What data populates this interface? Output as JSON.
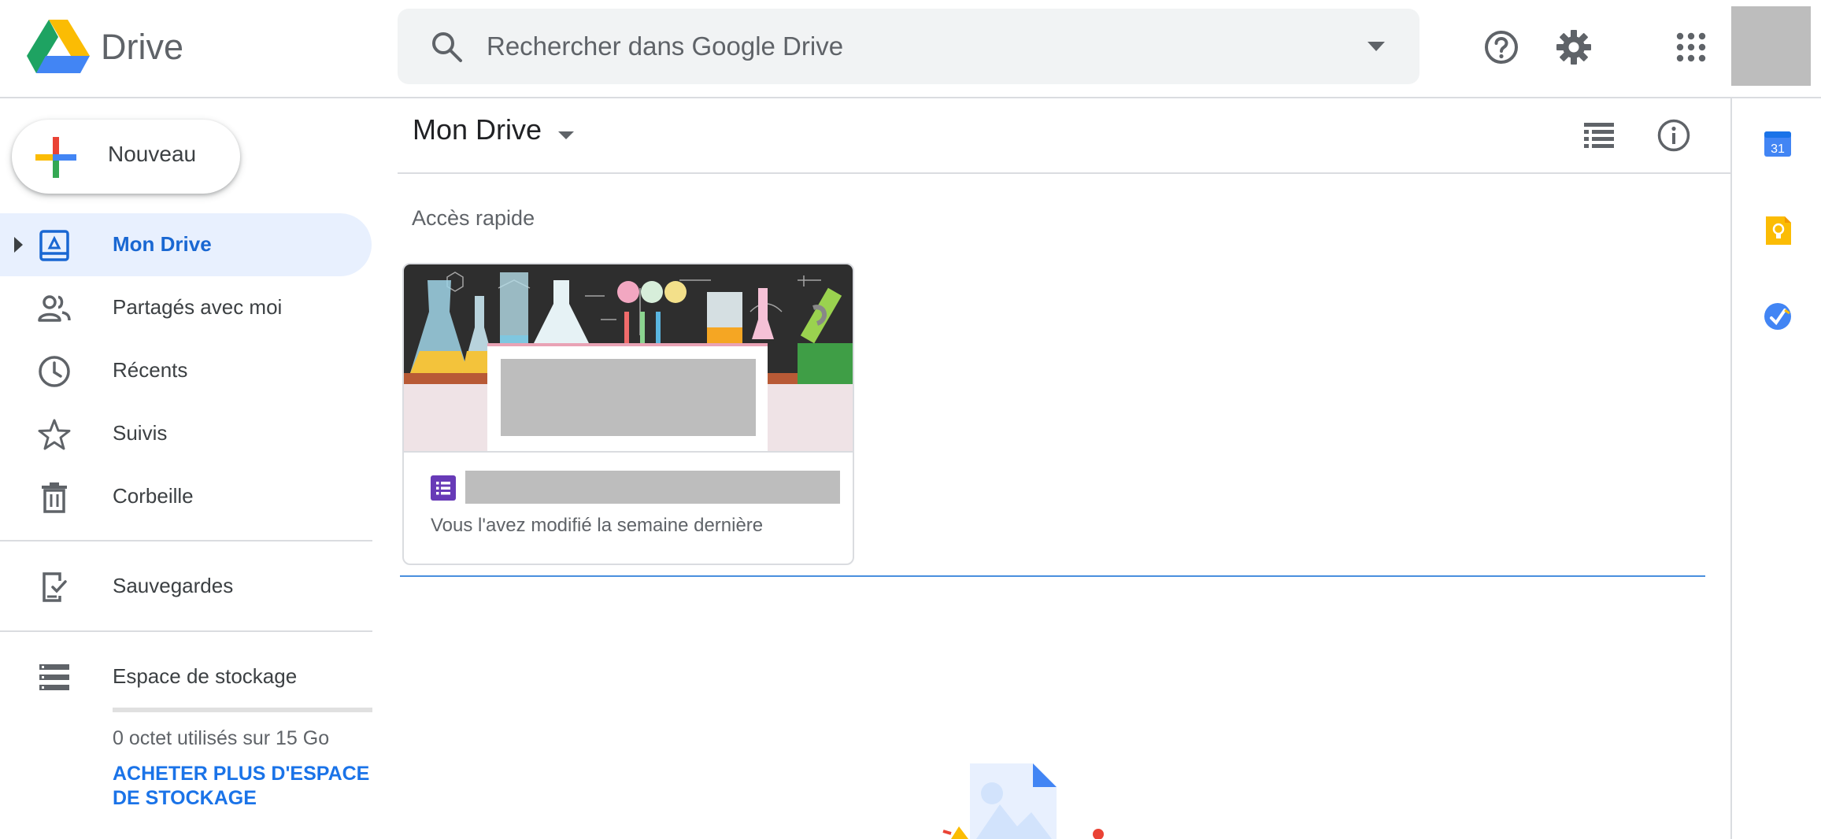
{
  "header": {
    "app_title": "Drive",
    "search_placeholder": "Rechercher dans Google Drive",
    "icons": [
      "google-drive-logo",
      "search-icon",
      "search-options-dropdown-icon",
      "help-icon",
      "settings-gear-icon",
      "apps-grid-icon",
      "account-avatar"
    ]
  },
  "sidebar": {
    "new_button_label": "Nouveau",
    "items": [
      {
        "label": "Mon Drive",
        "icon": "my-drive-icon",
        "selected": true
      },
      {
        "label": "Partagés avec moi",
        "icon": "people-icon"
      },
      {
        "label": "Récents",
        "icon": "clock-icon"
      },
      {
        "label": "Suivis",
        "icon": "star-icon"
      },
      {
        "label": "Corbeille",
        "icon": "trash-icon"
      },
      {
        "label": "Sauvegardes",
        "icon": "backup-device-icon"
      },
      {
        "label": "Espace de stockage",
        "icon": "storage-icon"
      }
    ],
    "storage_used_text": "0 octet utilisés sur 15 Go",
    "storage_used_fraction": 0,
    "buy_storage_label": "ACHETER PLUS D'ESPACE DE STOCKAGE"
  },
  "main": {
    "title": "Mon Drive",
    "quick_access_label": "Accès rapide",
    "cards": [
      {
        "type": "google-forms",
        "modified_text": "Vous l'avez modifié la semaine dernière"
      }
    ],
    "toolbar_icons": [
      "list-view-icon",
      "info-icon"
    ]
  },
  "side_panel": {
    "icons": [
      "google-calendar-icon",
      "google-keep-icon",
      "google-tasks-icon"
    ],
    "calendar_day": "31"
  },
  "colors": {
    "accent": "#1a73e8",
    "selected_bg": "#e8f0fe",
    "selected_text": "#1967d2",
    "search_bg": "#f1f3f4",
    "divider": "#dadce0"
  }
}
